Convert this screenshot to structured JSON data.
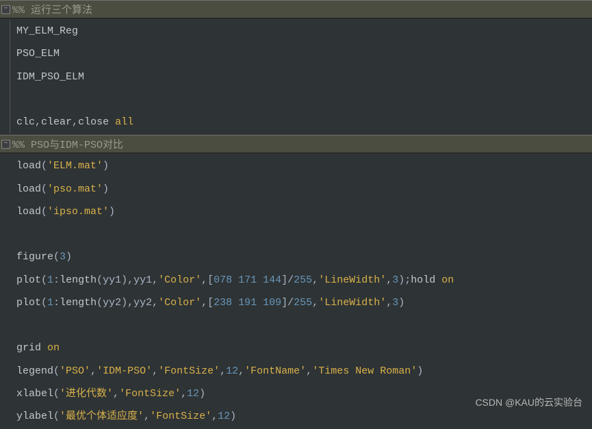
{
  "section1": {
    "header_prefix": "%%  ",
    "header_text": "运行三个算法",
    "lines": [
      {
        "tokens": [
          {
            "t": "MY_ELM_Reg",
            "c": "c-default"
          }
        ]
      },
      {
        "tokens": [
          {
            "t": "PSO_ELM",
            "c": "c-default"
          }
        ]
      },
      {
        "tokens": [
          {
            "t": "IDM_PSO_ELM",
            "c": "c-default"
          }
        ]
      },
      {
        "blank": true
      },
      {
        "tokens": [
          {
            "t": "clc",
            "c": "c-default"
          },
          {
            "t": ",",
            "c": "c-punct"
          },
          {
            "t": "clear",
            "c": "c-default"
          },
          {
            "t": ",",
            "c": "c-punct"
          },
          {
            "t": "close ",
            "c": "c-default"
          },
          {
            "t": "all",
            "c": "c-string"
          }
        ]
      }
    ]
  },
  "section2": {
    "header_prefix": "%% ",
    "header_text": "PSO与IDM-PSO对比",
    "lines": [
      {
        "tokens": [
          {
            "t": "load",
            "c": "c-default"
          },
          {
            "t": "(",
            "c": "c-punct"
          },
          {
            "t": "'ELM.mat'",
            "c": "c-string"
          },
          {
            "t": ")",
            "c": "c-punct"
          }
        ]
      },
      {
        "tokens": [
          {
            "t": "load",
            "c": "c-default"
          },
          {
            "t": "(",
            "c": "c-punct"
          },
          {
            "t": "'pso.mat'",
            "c": "c-string"
          },
          {
            "t": ")",
            "c": "c-punct"
          }
        ]
      },
      {
        "tokens": [
          {
            "t": "load",
            "c": "c-default"
          },
          {
            "t": "(",
            "c": "c-punct"
          },
          {
            "t": "'ipso.mat'",
            "c": "c-string"
          },
          {
            "t": ")",
            "c": "c-punct"
          }
        ]
      },
      {
        "blank": true
      },
      {
        "tokens": [
          {
            "t": "figure",
            "c": "c-default"
          },
          {
            "t": "(",
            "c": "c-punct"
          },
          {
            "t": "3",
            "c": "c-num"
          },
          {
            "t": ")",
            "c": "c-punct"
          }
        ]
      },
      {
        "tokens": [
          {
            "t": "plot",
            "c": "c-default"
          },
          {
            "t": "(",
            "c": "c-punct"
          },
          {
            "t": "1",
            "c": "c-num"
          },
          {
            "t": ":",
            "c": "c-punct"
          },
          {
            "t": "length",
            "c": "c-default"
          },
          {
            "t": "(yy1),yy1,",
            "c": "c-punct"
          },
          {
            "t": "'Color'",
            "c": "c-string"
          },
          {
            "t": ",[",
            "c": "c-punct"
          },
          {
            "t": "078 171 144",
            "c": "c-num"
          },
          {
            "t": "]/",
            "c": "c-punct"
          },
          {
            "t": "255",
            "c": "c-num"
          },
          {
            "t": ",",
            "c": "c-punct"
          },
          {
            "t": "'LineWidth'",
            "c": "c-string"
          },
          {
            "t": ",",
            "c": "c-punct"
          },
          {
            "t": "3",
            "c": "c-num"
          },
          {
            "t": ");",
            "c": "c-punct"
          },
          {
            "t": "hold ",
            "c": "c-default"
          },
          {
            "t": "on",
            "c": "c-string"
          }
        ]
      },
      {
        "tokens": [
          {
            "t": "plot",
            "c": "c-default"
          },
          {
            "t": "(",
            "c": "c-punct"
          },
          {
            "t": "1",
            "c": "c-num"
          },
          {
            "t": ":",
            "c": "c-punct"
          },
          {
            "t": "length",
            "c": "c-default"
          },
          {
            "t": "(yy2),yy2,",
            "c": "c-punct"
          },
          {
            "t": "'Color'",
            "c": "c-string"
          },
          {
            "t": ",[",
            "c": "c-punct"
          },
          {
            "t": "238 191 109",
            "c": "c-num"
          },
          {
            "t": "]/",
            "c": "c-punct"
          },
          {
            "t": "255",
            "c": "c-num"
          },
          {
            "t": ",",
            "c": "c-punct"
          },
          {
            "t": "'LineWidth'",
            "c": "c-string"
          },
          {
            "t": ",",
            "c": "c-punct"
          },
          {
            "t": "3",
            "c": "c-num"
          },
          {
            "t": ")",
            "c": "c-punct"
          }
        ]
      },
      {
        "blank": true
      },
      {
        "tokens": [
          {
            "t": "grid ",
            "c": "c-default"
          },
          {
            "t": "on",
            "c": "c-string"
          }
        ]
      },
      {
        "tokens": [
          {
            "t": "legend",
            "c": "c-default"
          },
          {
            "t": "(",
            "c": "c-punct"
          },
          {
            "t": "'PSO'",
            "c": "c-string"
          },
          {
            "t": ",",
            "c": "c-punct"
          },
          {
            "t": "'IDM-PSO'",
            "c": "c-string"
          },
          {
            "t": ",",
            "c": "c-punct"
          },
          {
            "t": "'FontSize'",
            "c": "c-string"
          },
          {
            "t": ",",
            "c": "c-punct"
          },
          {
            "t": "12",
            "c": "c-num"
          },
          {
            "t": ",",
            "c": "c-punct"
          },
          {
            "t": "'FontName'",
            "c": "c-string"
          },
          {
            "t": ",",
            "c": "c-punct"
          },
          {
            "t": "'Times New Roman'",
            "c": "c-string"
          },
          {
            "t": ")",
            "c": "c-punct"
          }
        ]
      },
      {
        "tokens": [
          {
            "t": "xlabel",
            "c": "c-default"
          },
          {
            "t": "(",
            "c": "c-punct"
          },
          {
            "t": "'进化代数'",
            "c": "c-string"
          },
          {
            "t": ",",
            "c": "c-punct"
          },
          {
            "t": "'FontSize'",
            "c": "c-string"
          },
          {
            "t": ",",
            "c": "c-punct"
          },
          {
            "t": "12",
            "c": "c-num"
          },
          {
            "t": ")",
            "c": "c-punct"
          }
        ]
      },
      {
        "tokens": [
          {
            "t": "ylabel",
            "c": "c-default"
          },
          {
            "t": "(",
            "c": "c-punct"
          },
          {
            "t": "'最优个体适应度'",
            "c": "c-string"
          },
          {
            "t": ",",
            "c": "c-punct"
          },
          {
            "t": "'FontSize'",
            "c": "c-string"
          },
          {
            "t": ",",
            "c": "c-punct"
          },
          {
            "t": "12",
            "c": "c-num"
          },
          {
            "t": ")",
            "c": "c-punct"
          }
        ]
      }
    ]
  },
  "watermark": "CSDN @KAU的云实验台"
}
